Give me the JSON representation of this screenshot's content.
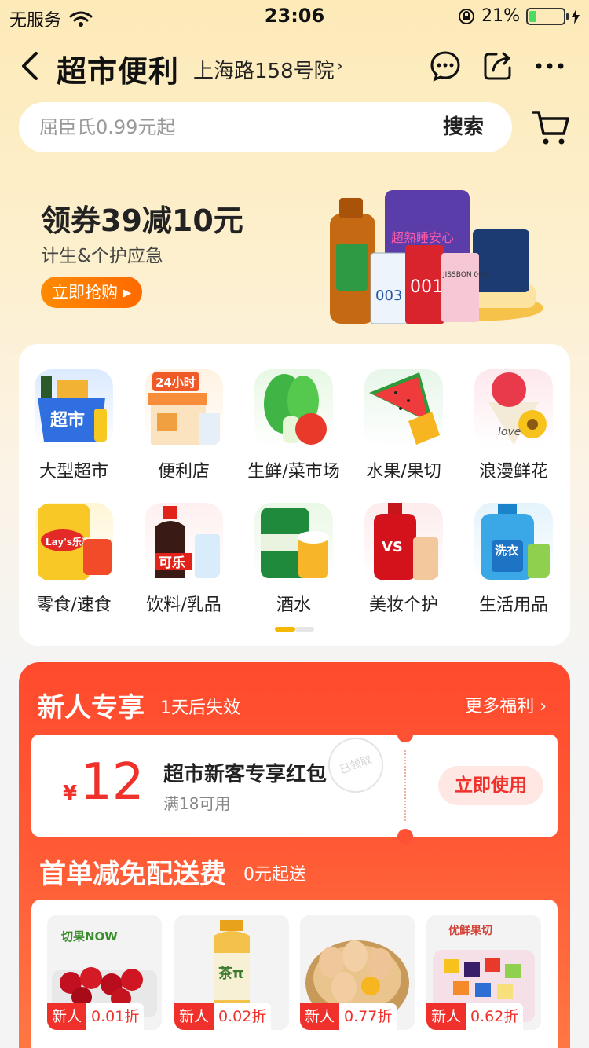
{
  "status_bar": {
    "carrier": "无服务",
    "time": "23:06",
    "battery": "21%",
    "battery_level": 0.21
  },
  "nav": {
    "title": "超市便利",
    "address": "上海路158号院",
    "address_chevron": "›"
  },
  "search": {
    "placeholder": "屈臣氏0.99元起",
    "button_label": "搜索"
  },
  "banner": {
    "headline": "领券39减10元",
    "subtitle": "计生&个护应急",
    "cta": "立即抢购 ▸",
    "product_art_labels": [
      "超熟睡安心",
      "003",
      "001",
      "JISSBON 003"
    ]
  },
  "categories": [
    {
      "label": "大型超市",
      "icon": "supermarket-basket-icon",
      "badge": "超市"
    },
    {
      "label": "便利店",
      "icon": "convenience-store-icon",
      "badge": "24小时"
    },
    {
      "label": "生鲜/菜市场",
      "icon": "vegetables-icon"
    },
    {
      "label": "水果/果切",
      "icon": "watermelon-icon"
    },
    {
      "label": "浪漫鲜花",
      "icon": "flowers-icon",
      "badge": "love"
    },
    {
      "label": "零食/速食",
      "icon": "snacks-icon",
      "badge": "Lay's乐事"
    },
    {
      "label": "饮料/乳品",
      "icon": "cola-icon",
      "badge": "可乐"
    },
    {
      "label": "酒水",
      "icon": "beer-icon"
    },
    {
      "label": "美妆个护",
      "icon": "cosmetics-icon",
      "badge": "VS"
    },
    {
      "label": "生活用品",
      "icon": "detergent-icon",
      "badge": "洗衣"
    }
  ],
  "pager": {
    "active_index": 0,
    "pages": 2
  },
  "newcomer": {
    "title": "新人专享",
    "expire": "1天后失效",
    "more": "更多福利 ›",
    "coupon": {
      "currency": "¥",
      "amount": "12",
      "title": "超市新客专享红包",
      "condition": "满18可用",
      "stamp": "已领取",
      "button": "立即使用"
    }
  },
  "delivery": {
    "title": "首单减免配送费",
    "subtitle": "0元起送",
    "products": [
      {
        "tag": "新人",
        "discount": "0.01折",
        "icon": "cherries-icon",
        "brand": "切果NOW"
      },
      {
        "tag": "新人",
        "discount": "0.02折",
        "icon": "tea-bottle-icon",
        "brand": "茶π"
      },
      {
        "tag": "新人",
        "discount": "0.77折",
        "icon": "eggs-icon"
      },
      {
        "tag": "新人",
        "discount": "0.62折",
        "icon": "fruit-salad-icon",
        "brand": "优鲜果切"
      }
    ]
  },
  "colors": {
    "accent_orange": "#ff7a00",
    "promo_red": "#ff4a2d",
    "price_red": "#f0302a",
    "pager_active": "#f5b800"
  }
}
